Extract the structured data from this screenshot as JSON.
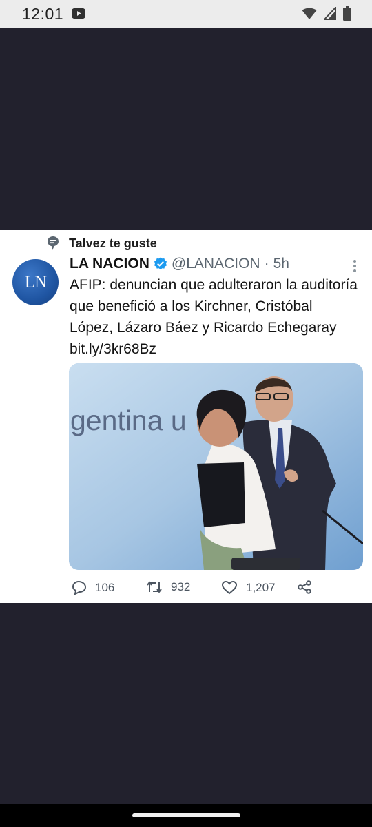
{
  "status_bar": {
    "time": "12:01",
    "icons": [
      "youtube-icon",
      "wifi-icon",
      "signal-icon",
      "battery-icon"
    ]
  },
  "tweet": {
    "context_label": "Talvez te guste",
    "avatar_text": "LN",
    "display_name": "LA NACION",
    "verified": true,
    "handle": "@LANACION",
    "separator": "·",
    "time_ago": "5h",
    "text": "AFIP: denuncian que adulteraron la auditoría que benefició a los Kirchner, Cristóbal López, Lázaro Báez y Ricardo Echegaray bit.ly/3kr68Bz",
    "media_banner_text": "gentina u",
    "actions": {
      "replies": "106",
      "retweets": "932",
      "likes": "1,207"
    }
  },
  "colors": {
    "page_background": "#22212d",
    "card_background": "#ffffff",
    "verified_blue": "#1d9bf0",
    "muted_text": "#5b6670",
    "avatar_blue": "#1f55a2"
  }
}
